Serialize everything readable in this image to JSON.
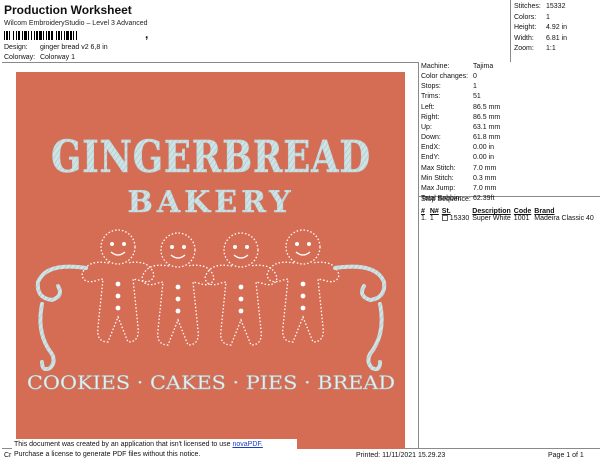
{
  "header": {
    "title": "Production Worksheet",
    "subtitle": "Wilcom EmbroideryStudio – Level 3 Advanced",
    "barcode_suffix": ",",
    "design_label": "Design:",
    "design_value": "ginger bread v2 6,8 in",
    "colorway_label": "Colorway:",
    "colorway_value": "Colorway 1"
  },
  "stats": [
    {
      "label": "Stitches:",
      "value": "15332"
    },
    {
      "label": "Colors:",
      "value": "1"
    },
    {
      "label": "Height:",
      "value": "4.92 in"
    },
    {
      "label": "Width:",
      "value": "6.81 in"
    },
    {
      "label": "Zoom:",
      "value": "1:1"
    }
  ],
  "design": {
    "background_color": "#d56d55",
    "thread_color": "#cfe3e5",
    "lines": [
      "GINGERBREAD",
      "BAKERY",
      "COOKIES · CAKES · PIES · BREAD"
    ]
  },
  "machine": [
    {
      "label": "Machine:",
      "value": "Tajima"
    },
    {
      "label": "Color changes:",
      "value": "0"
    },
    {
      "label": "Stops:",
      "value": "1"
    },
    {
      "label": "Trims:",
      "value": "51"
    },
    {
      "label": "Left:",
      "value": "86.5 mm"
    },
    {
      "label": "Right:",
      "value": "86.5 mm"
    },
    {
      "label": "Up:",
      "value": "63.1 mm"
    },
    {
      "label": "Down:",
      "value": "61.8 mm"
    },
    {
      "label": "EndX:",
      "value": "0.00 in"
    },
    {
      "label": "EndY:",
      "value": "0.00 in"
    },
    {
      "label": "Max Stitch:",
      "value": "7.0 mm"
    },
    {
      "label": "Min Stitch:",
      "value": "0.3 mm"
    },
    {
      "label": "Max Jump:",
      "value": "7.0 mm"
    },
    {
      "label": "Total Bobbin:",
      "value": "62.39ft"
    }
  ],
  "sequence": {
    "title": "Stop Sequence:",
    "headers": [
      "#",
      "N#",
      "St.",
      "Description",
      "Code",
      "Brand"
    ],
    "rows": [
      {
        "num": "1.",
        "n": "1",
        "st": "15330",
        "description": "Super White",
        "code": "1001",
        "brand": "Madeira Classic 40"
      }
    ]
  },
  "notice": {
    "line1": "This document was created by an application that isn't licensed to use",
    "link": "novaPDF.",
    "line2": "Purchase a license to generate PDF files without this notice."
  },
  "footer": {
    "cr": "Cr",
    "printed": "Printed: 11/11/2021 15.29.23",
    "page": "Page 1 of 1"
  }
}
